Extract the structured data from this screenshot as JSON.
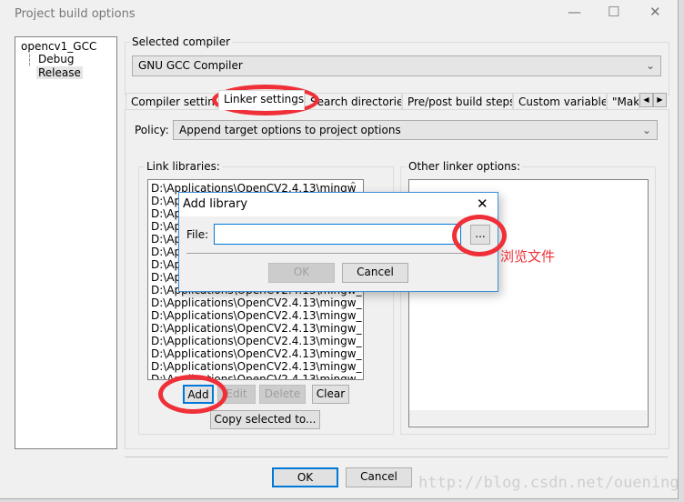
{
  "window": {
    "title": "Project build options",
    "minimize_icon": "minimize-icon",
    "maximize_icon": "maximize-icon",
    "close_icon": "close-icon"
  },
  "tree": {
    "root": "opencv1_GCC",
    "children": [
      "Debug",
      "Release"
    ],
    "selected": "Release"
  },
  "compiler": {
    "group_label": "Selected compiler",
    "value": "GNU GCC Compiler"
  },
  "tabs": [
    {
      "label": "Compiler settings"
    },
    {
      "label": "Linker settings",
      "active": true
    },
    {
      "label": "Search directories"
    },
    {
      "label": "Pre/post build steps"
    },
    {
      "label": "Custom variables"
    },
    {
      "label": "\"Make\" commands"
    }
  ],
  "policy": {
    "label": "Policy:",
    "value": "Append target options to project options"
  },
  "link_libraries": {
    "label": "Link libraries:",
    "items": [
      "D:\\Applications\\OpenCV2.4.13\\mingw_",
      "D:\\Applications\\OpenCV2.4.13\\mingw_",
      "D:\\Applications\\OpenCV2.4.13\\mingw_",
      "D:\\Applications\\OpenCV2.4.13\\mingw_",
      "D:\\Applications\\OpenCV2.4.13\\mingw_",
      "D:\\Applications\\OpenCV2.4.13\\mingw_",
      "D:\\Applications\\OpenCV2.4.13\\mingw_",
      "D:\\Applications\\OpenCV2.4.13\\mingw_",
      "D:\\Applications\\OpenCV2.4.13\\mingw_",
      "D:\\Applications\\OpenCV2.4.13\\mingw_",
      "D:\\Applications\\OpenCV2.4.13\\mingw_",
      "D:\\Applications\\OpenCV2.4.13\\mingw_",
      "D:\\Applications\\OpenCV2.4.13\\mingw_",
      "D:\\Applications\\OpenCV2.4.13\\mingw_",
      "D:\\Applications\\OpenCV2.4.13\\mingw_",
      "D:\\Applications\\OpenCV2.4.13\\mingw_"
    ],
    "add": "Add",
    "edit": "Edit",
    "delete": "Delete",
    "clear": "Clear",
    "copy": "Copy selected to..."
  },
  "other_linker": {
    "label": "Other linker options:",
    "value": ""
  },
  "footer": {
    "ok": "OK",
    "cancel": "Cancel"
  },
  "dialog": {
    "title": "Add library",
    "file_label": "File:",
    "file_value": "",
    "browse": "...",
    "ok": "OK",
    "cancel": "Cancel"
  },
  "annotation": {
    "text": "浏览文件",
    "color": "#f03038"
  },
  "watermark": "http://blog.csdn.net/ouening"
}
